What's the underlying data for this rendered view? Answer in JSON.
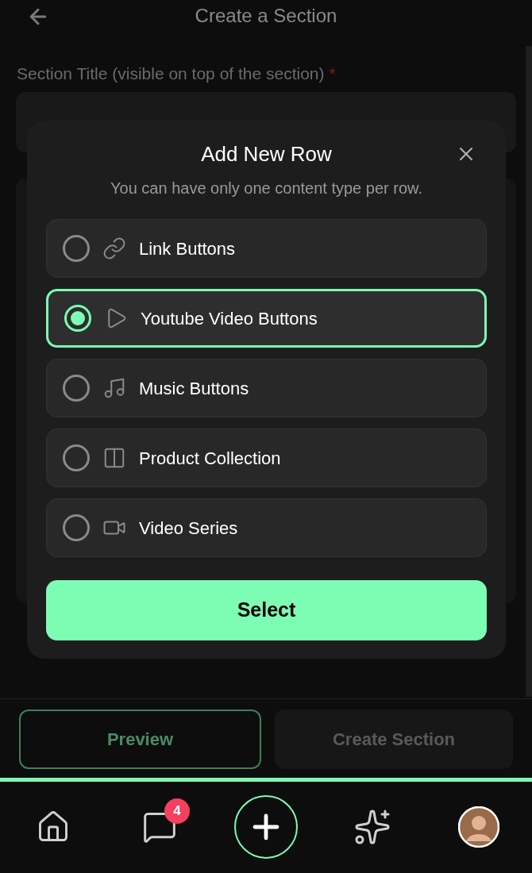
{
  "header": {
    "title": "Create a Section"
  },
  "form": {
    "label": "Section Title (visible on top of the section)",
    "required_mark": "*"
  },
  "dialog": {
    "title": "Add New Row",
    "subtitle": "You can have only one content type per row.",
    "options": [
      {
        "kind": "link",
        "label": "Link Buttons",
        "selected": false
      },
      {
        "kind": "play",
        "label": "Youtube Video Buttons",
        "selected": true
      },
      {
        "kind": "music",
        "label": "Music Buttons",
        "selected": false
      },
      {
        "kind": "columns",
        "label": "Product Collection",
        "selected": false
      },
      {
        "kind": "video",
        "label": "Video Series",
        "selected": false
      }
    ],
    "confirm": "Select"
  },
  "actions": {
    "secondary": "Preview",
    "primary": "Create Section",
    "primary_disabled": true
  },
  "nav": {
    "items": [
      {
        "kind": "home"
      },
      {
        "kind": "messages",
        "badge": "4"
      },
      {
        "kind": "add"
      },
      {
        "kind": "sparkle"
      },
      {
        "kind": "avatar"
      }
    ]
  }
}
